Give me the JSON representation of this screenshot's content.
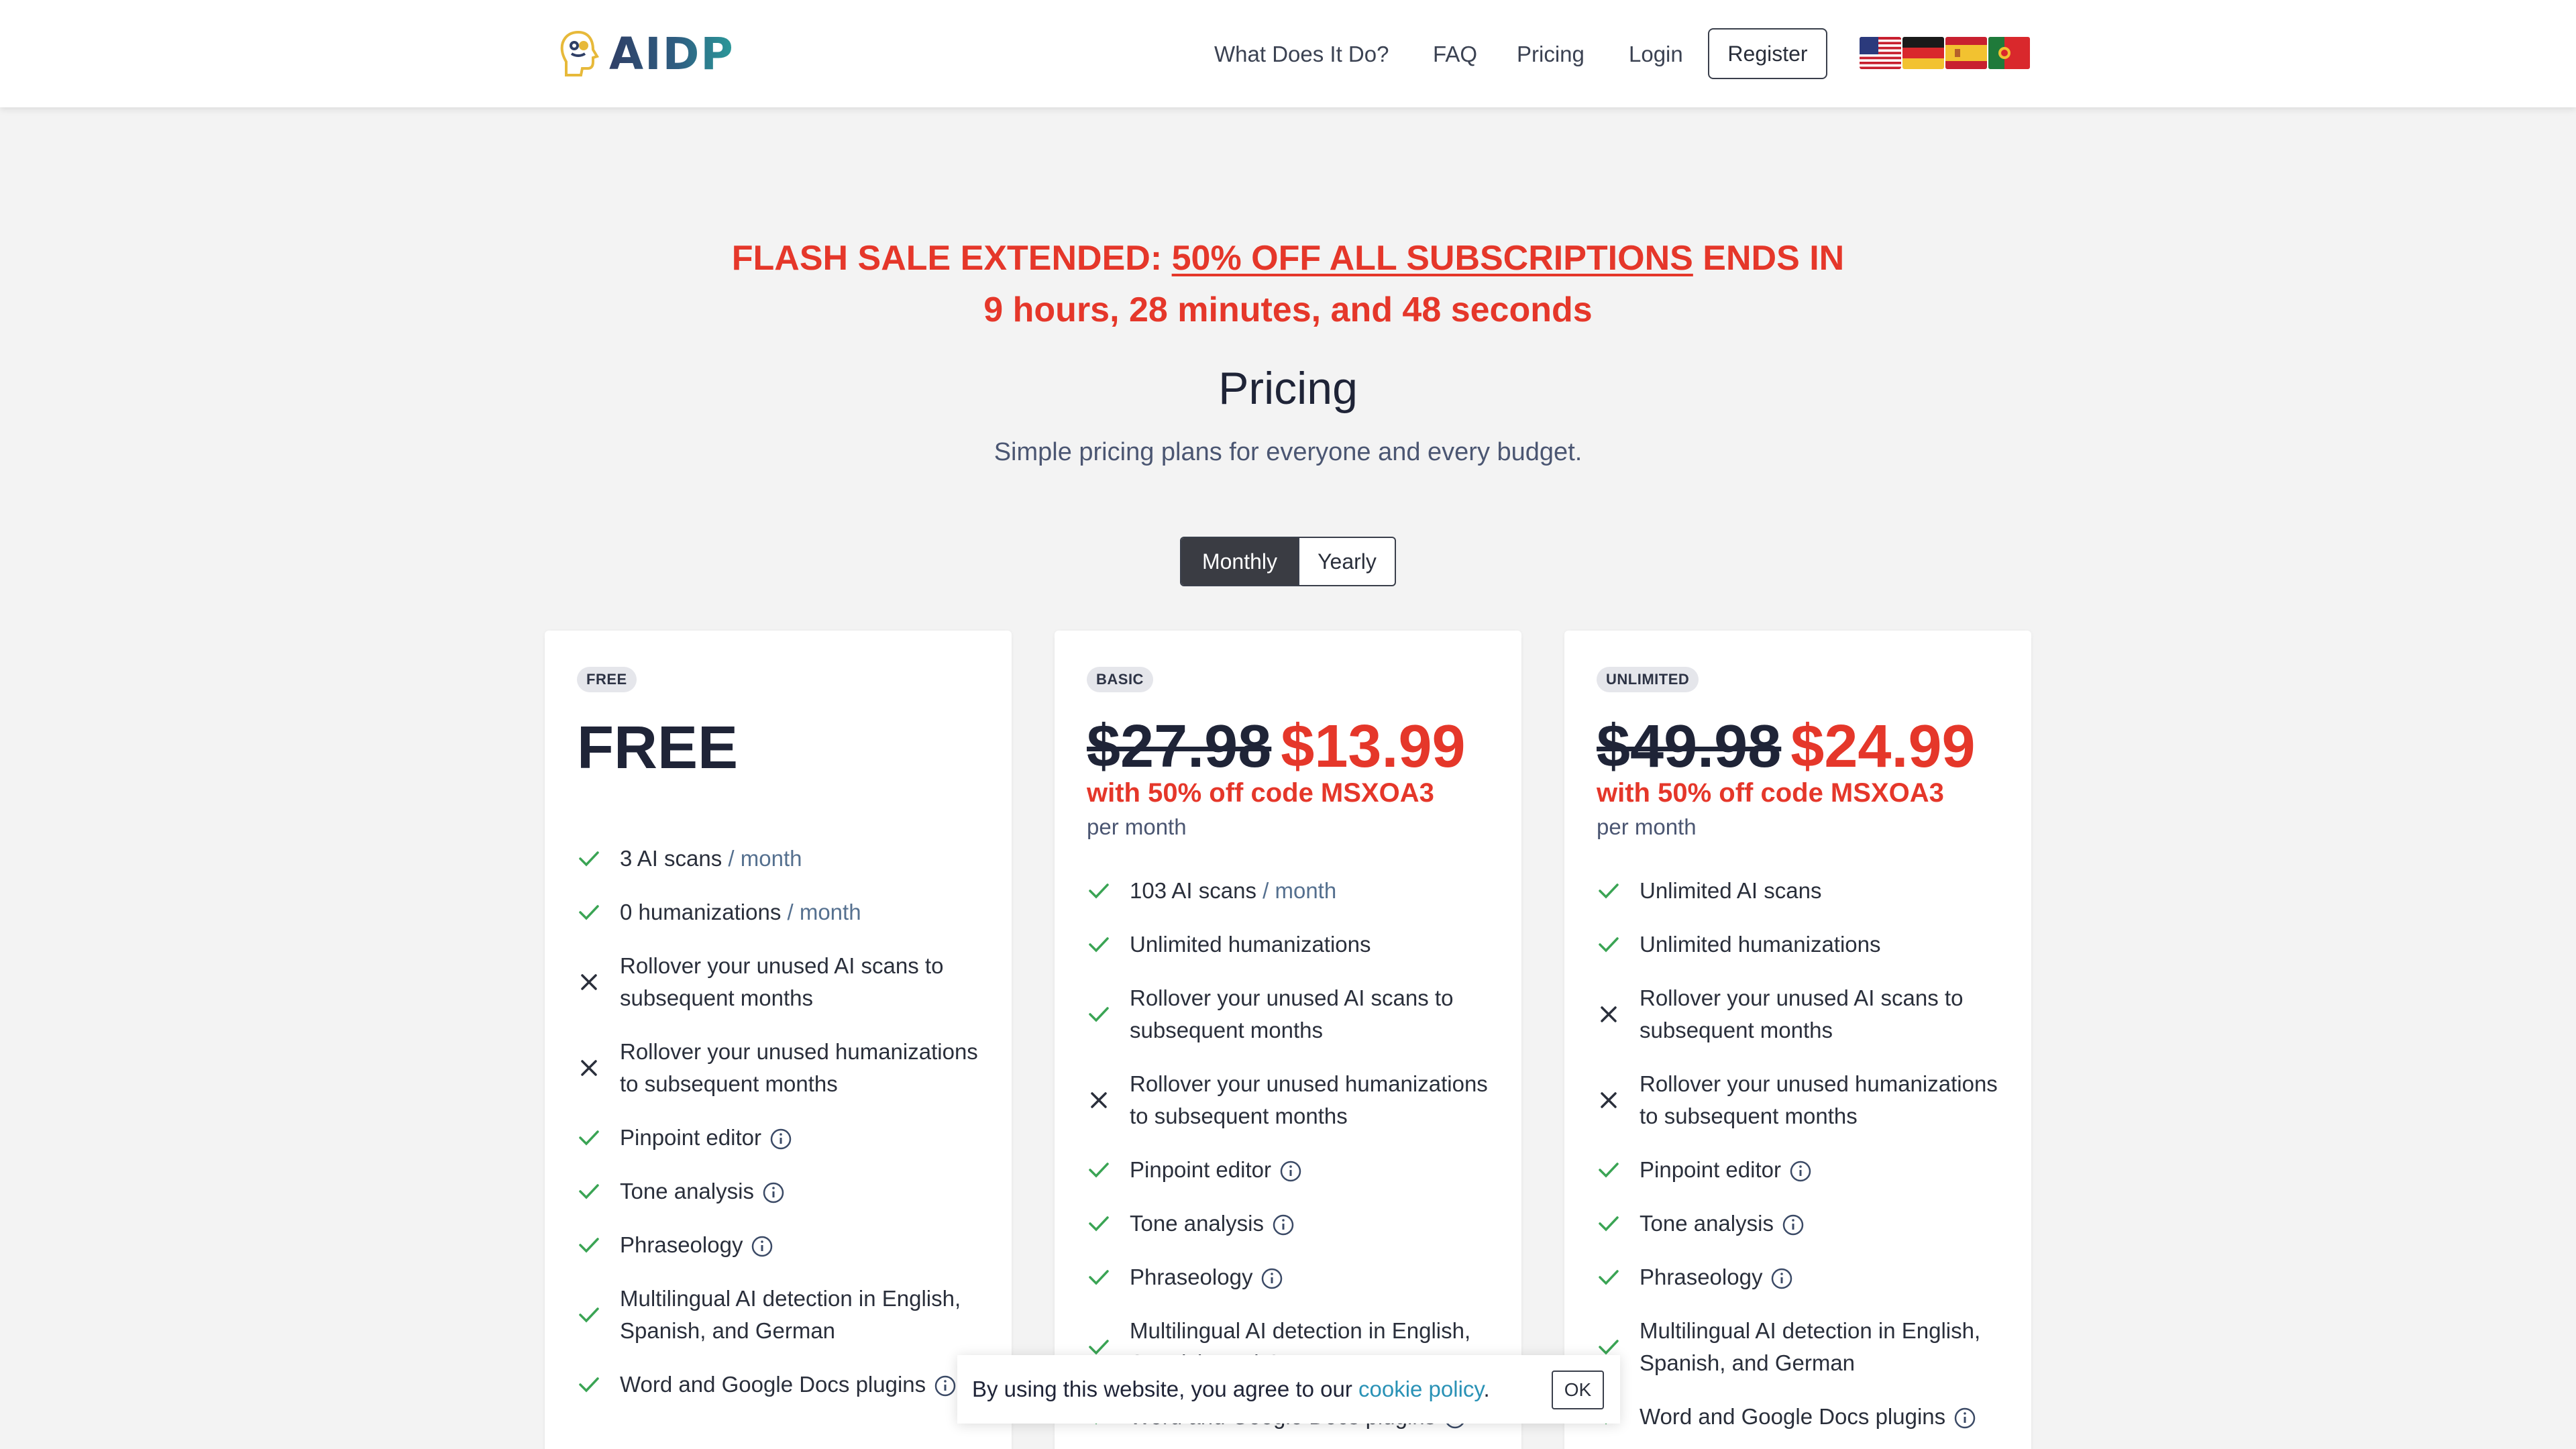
{
  "header": {
    "logo_text": "AIDP",
    "nav": [
      {
        "label": "What Does It Do?"
      },
      {
        "label": "FAQ"
      },
      {
        "label": "Pricing"
      },
      {
        "label": "Login"
      }
    ],
    "register_label": "Register",
    "flags": [
      "us-flag",
      "germany-flag",
      "spain-flag",
      "portugal-flag"
    ]
  },
  "sale": {
    "prefix": "FLASH SALE EXTENDED: ",
    "highlight": "50% OFF ALL SUBSCRIPTIONS",
    "suffix": " ENDS IN",
    "countdown": "9 hours, 28 minutes, and 48 seconds"
  },
  "page": {
    "title": "Pricing",
    "subtitle": "Simple pricing plans for everyone and every budget."
  },
  "billing_toggle": {
    "options": [
      "Monthly",
      "Yearly"
    ],
    "selected": "Monthly"
  },
  "colors": {
    "accent_red": "#e5372a",
    "check_green": "#3aa454",
    "cross_navy": "#2a2f3b",
    "link_teal": "#2a92b6"
  },
  "plans": [
    {
      "badge": "FREE",
      "price_free": "FREE",
      "features": [
        {
          "icon": "check-icon",
          "text": "3 AI scans",
          "unit": " / month"
        },
        {
          "icon": "check-icon",
          "text": "0 humanizations",
          "unit": " / month"
        },
        {
          "icon": "cross-icon",
          "text": "Rollover your unused AI scans to subsequent months"
        },
        {
          "icon": "cross-icon",
          "text": "Rollover your unused humanizations to subsequent months"
        },
        {
          "icon": "check-icon",
          "text": "Pinpoint editor",
          "info": true
        },
        {
          "icon": "check-icon",
          "text": "Tone analysis",
          "info": true
        },
        {
          "icon": "check-icon",
          "text": "Phraseology",
          "info": true
        },
        {
          "icon": "check-icon",
          "text": "Multilingual AI detection in English, Spanish, and German"
        },
        {
          "icon": "check-icon",
          "text": "Word and Google Docs plugins",
          "info": true
        }
      ]
    },
    {
      "badge": "BASIC",
      "price_old": "$27.98",
      "price_new": "$13.99",
      "code_note": "with 50% off code MSXOA3",
      "period": "per month",
      "features": [
        {
          "icon": "check-icon",
          "text": "103 AI scans",
          "unit": " / month"
        },
        {
          "icon": "check-icon",
          "text": "Unlimited humanizations"
        },
        {
          "icon": "check-icon",
          "text": "Rollover your unused AI scans to subsequent months"
        },
        {
          "icon": "cross-icon",
          "text": "Rollover your unused humanizations to subsequent months"
        },
        {
          "icon": "check-icon",
          "text": "Pinpoint editor",
          "info": true
        },
        {
          "icon": "check-icon",
          "text": "Tone analysis",
          "info": true
        },
        {
          "icon": "check-icon",
          "text": "Phraseology",
          "info": true
        },
        {
          "icon": "check-icon",
          "text": "Multilingual AI detection in English, Spanish, and German"
        },
        {
          "icon": "check-icon",
          "text": "Word and Google Docs plugins",
          "info": true
        }
      ]
    },
    {
      "badge": "UNLIMITED",
      "price_old": "$49.98",
      "price_new": "$24.99",
      "code_note": "with 50% off code MSXOA3",
      "period": "per month",
      "features": [
        {
          "icon": "check-icon",
          "text": "Unlimited AI scans"
        },
        {
          "icon": "check-icon",
          "text": "Unlimited humanizations"
        },
        {
          "icon": "cross-icon",
          "text": "Rollover your unused AI scans to subsequent months"
        },
        {
          "icon": "cross-icon",
          "text": "Rollover your unused humanizations to subsequent months"
        },
        {
          "icon": "check-icon",
          "text": "Pinpoint editor",
          "info": true
        },
        {
          "icon": "check-icon",
          "text": "Tone analysis",
          "info": true
        },
        {
          "icon": "check-icon",
          "text": "Phraseology",
          "info": true
        },
        {
          "icon": "check-icon",
          "text": "Multilingual AI detection in English, Spanish, and German"
        },
        {
          "icon": "check-icon",
          "text": "Word and Google Docs plugins",
          "info": true
        }
      ]
    }
  ],
  "cookie": {
    "text": "By using this website, you agree to our ",
    "link": "cookie policy",
    "suffix": ".",
    "ok_label": "OK"
  }
}
